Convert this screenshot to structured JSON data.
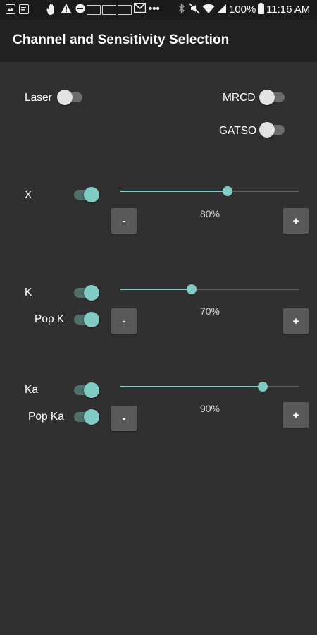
{
  "status_bar": {
    "battery_percent": "100%",
    "time": "11:16 AM",
    "icons": [
      "photo-icon",
      "message-icon",
      "hand-icon",
      "warning-icon",
      "minus-circle-icon",
      "news-icon",
      "news-icon",
      "news-icon",
      "gmail-icon",
      "more-icon",
      "bluetooth-icon",
      "mute-icon",
      "wifi-icon",
      "signal-icon",
      "battery-icon"
    ]
  },
  "app_bar": {
    "title": "Channel and Sensitivity Selection"
  },
  "toggles": {
    "laser": {
      "label": "Laser",
      "on": false
    },
    "mrcd": {
      "label": "MRCD",
      "on": false
    },
    "gatso": {
      "label": "GATSO",
      "on": false
    }
  },
  "bands": {
    "x": {
      "label": "X",
      "on": true,
      "sensitivity": "80%",
      "level": 0.6
    },
    "k": {
      "label": "K",
      "on": true,
      "pop_label": "Pop K",
      "pop_on": true,
      "sensitivity": "70%",
      "level": 0.4
    },
    "ka": {
      "label": "Ka",
      "on": true,
      "pop_label": "Pop Ka",
      "pop_on": true,
      "sensitivity": "90%",
      "level": 0.8
    }
  },
  "buttons": {
    "minus": "-",
    "plus": "+"
  },
  "colors": {
    "accent": "#80cbc4",
    "background": "#303030",
    "app_bar": "#212121",
    "status_bar": "#1b1b1b",
    "button": "#595959"
  }
}
